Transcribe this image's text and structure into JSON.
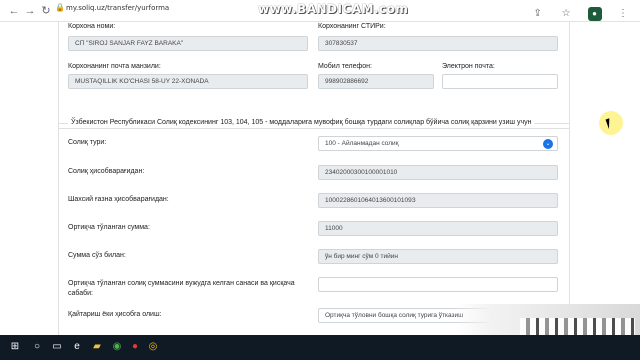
{
  "browser": {
    "url": "my.soliq.uz/transfer/yurforma",
    "watermark": "www.BANDICAM.com"
  },
  "company": {
    "name_label": "Корхона номи:",
    "name_value": "СП \"SIROJ SANJAR FAYZ BARAKA\"",
    "tin_label": "Корхонанинг СТИРи:",
    "tin_value": "307830537",
    "address_label": "Корхонанинг почта манзили:",
    "address_value": "MUSTAQILLIK KO'CHASI 58-UY 22-XONADA",
    "phone_label": "Мобил телефон:",
    "phone_value": "998902886692",
    "email_label": "Электрон почта:",
    "email_value": ""
  },
  "form": {
    "legend": "Ўзбекистон Республикаси Солиқ кодексининг 103, 104, 105 - моддаларига мувофиқ бошқа турдаги солиқлар бўйича солиқ қарзини узиш учун",
    "tax_type_label": "Солиқ тури:",
    "tax_type_value": "100 - Айланмадан солиқ",
    "tax_account_label": "Солиқ ҳисобварағидан:",
    "tax_account_value": "23402000300100001010",
    "personal_account_label": "Шахсий ғазна ҳисобварағидан:",
    "personal_account_value": "100022860106401360010109З",
    "overpaid_label": "Ортиқча тўланган сумма:",
    "overpaid_value": "11000",
    "words_label": "Сумма сўз билан:",
    "words_value": "ўн бир минг сўм 0 тийин",
    "date_reason_label": "Ортиқча тўланган солиқ суммасини вужудга келган санаси ва қисқача сабаби:",
    "date_reason_value": "",
    "refund_label": "Қайтариш ёки ҳисобга олиш:",
    "refund_value": "Ортиқча тўловни бошқа солиқ турига ўтказиш"
  }
}
